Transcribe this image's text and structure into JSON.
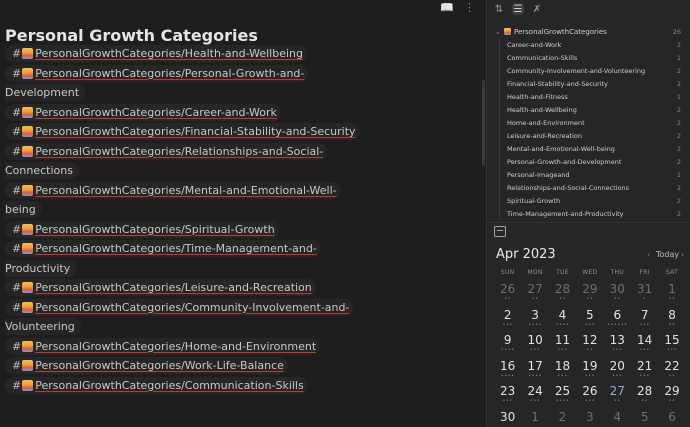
{
  "editor": {
    "title": "Personal Growth Categories",
    "tags": [
      {
        "text": "PersonalGrowthCategories/Health-and-Wellbeing"
      },
      {
        "text": "PersonalGrowthCategories/Personal-Growth-and-",
        "continuation": "Development"
      },
      {
        "text": "PersonalGrowthCategories/Career-and-Work"
      },
      {
        "text": "PersonalGrowthCategories/Financial-Stability-and-Security"
      },
      {
        "text": "PersonalGrowthCategories/Relationships-and-Social-",
        "continuation": "Connections"
      },
      {
        "text": "PersonalGrowthCategories/Mental-and-Emotional-Well-",
        "continuation": "being"
      },
      {
        "text": "PersonalGrowthCategories/Spiritual-Growth"
      },
      {
        "text": "PersonalGrowthCategories/Time-Management-and-",
        "continuation": "Productivity"
      },
      {
        "text": "PersonalGrowthCategories/Leisure-and-Recreation"
      },
      {
        "text": "PersonalGrowthCategories/Community-Involvement-and-",
        "continuation": "Volunteering"
      },
      {
        "text": "PersonalGrowthCategories/Home-and-Environment"
      },
      {
        "text": "PersonalGrowthCategories/Work-Life-Balance"
      },
      {
        "text": "PersonalGrowthCategories/Communication-Skills"
      }
    ],
    "hash": "#",
    "icons": [
      "book-icon",
      "more-options-icon"
    ]
  },
  "sidebar": {
    "tab_icons": [
      "sort-icon",
      "tag-tree-icon",
      "collapse-icon"
    ],
    "tree": {
      "root": {
        "label": "PersonalGrowthCategories",
        "count": "26"
      },
      "items": [
        {
          "label": "Career-and-Work",
          "count": "2"
        },
        {
          "label": "Communication-Skills",
          "count": "1"
        },
        {
          "label": "Community-Involvement-and-Volunteering",
          "count": "2"
        },
        {
          "label": "Financial-Stability-and-Security",
          "count": "2"
        },
        {
          "label": "Health-and-Fitness",
          "count": "1"
        },
        {
          "label": "Health-and-Wellbeing",
          "count": "2"
        },
        {
          "label": "Home-and-Environment",
          "count": "2"
        },
        {
          "label": "Leisure-and-Recreation",
          "count": "2"
        },
        {
          "label": "Mental-and-Emotional-Well-being",
          "count": "2"
        },
        {
          "label": "Personal-Growth-and-Development",
          "count": "2"
        },
        {
          "label": "Personal-Imageand",
          "count": "1"
        },
        {
          "label": "Relationships-and-Social-Connections",
          "count": "2"
        },
        {
          "label": "Spiritual-Growth",
          "count": "2"
        },
        {
          "label": "Time-Management-and-Productivity",
          "count": "2"
        }
      ]
    }
  },
  "calendar": {
    "month_label": "Apr 2023",
    "today_label": "Today",
    "prev_symbol": "‹",
    "next_symbol": "›",
    "weekdays": [
      "SUN",
      "MON",
      "TUE",
      "WED",
      "THU",
      "FRI",
      "SAT"
    ],
    "days": [
      {
        "n": "26",
        "dim": true,
        "dots": "••"
      },
      {
        "n": "27",
        "dim": true,
        "dots": "••"
      },
      {
        "n": "28",
        "dim": true,
        "dots": "••"
      },
      {
        "n": "29",
        "dim": true,
        "dots": "••"
      },
      {
        "n": "30",
        "dim": true,
        "dots": "••"
      },
      {
        "n": "31",
        "dim": true,
        "dots": "•"
      },
      {
        "n": "1",
        "dim": true,
        "dots": "••"
      },
      {
        "n": "2",
        "dots": "•••"
      },
      {
        "n": "3",
        "dots": "••••"
      },
      {
        "n": "4",
        "dots": "••••"
      },
      {
        "n": "5",
        "dots": "•••"
      },
      {
        "n": "6",
        "dots": "••••••"
      },
      {
        "n": "7",
        "dots": "•••"
      },
      {
        "n": "8",
        "dots": "••"
      },
      {
        "n": "9",
        "dots": "••••"
      },
      {
        "n": "10",
        "dots": "•••"
      },
      {
        "n": "11",
        "dots": "•••"
      },
      {
        "n": "12",
        "dots": "••"
      },
      {
        "n": "13",
        "dots": "•••"
      },
      {
        "n": "14",
        "dots": "•••"
      },
      {
        "n": "15",
        "dots": "•••"
      },
      {
        "n": "16",
        "dots": "••••"
      },
      {
        "n": "17",
        "dots": "••••"
      },
      {
        "n": "18",
        "dots": "•••"
      },
      {
        "n": "19",
        "dots": "•••"
      },
      {
        "n": "20",
        "dots": "•••"
      },
      {
        "n": "21",
        "dots": "•••"
      },
      {
        "n": "22",
        "dots": "••"
      },
      {
        "n": "23",
        "dots": "•••"
      },
      {
        "n": "24",
        "dots": "•••"
      },
      {
        "n": "25",
        "dots": "••••"
      },
      {
        "n": "26",
        "dots": "•••"
      },
      {
        "n": "27",
        "today": true,
        "dots": "••"
      },
      {
        "n": "28",
        "dots": "••"
      },
      {
        "n": "29",
        "dots": "••"
      },
      {
        "n": "30",
        "dots": ""
      },
      {
        "n": "1",
        "dim": true,
        "dots": ""
      },
      {
        "n": "2",
        "dim": true,
        "dots": ""
      },
      {
        "n": "3",
        "dim": true,
        "dots": ""
      },
      {
        "n": "4",
        "dim": true,
        "dots": ""
      },
      {
        "n": "5",
        "dim": true,
        "dots": ""
      },
      {
        "n": "6",
        "dim": true,
        "dots": ""
      }
    ]
  },
  "colors": {
    "background": "#1e1e1e",
    "sidebar": "#262626",
    "link_underline": "#c0392b",
    "today": "#8fb4d9"
  }
}
